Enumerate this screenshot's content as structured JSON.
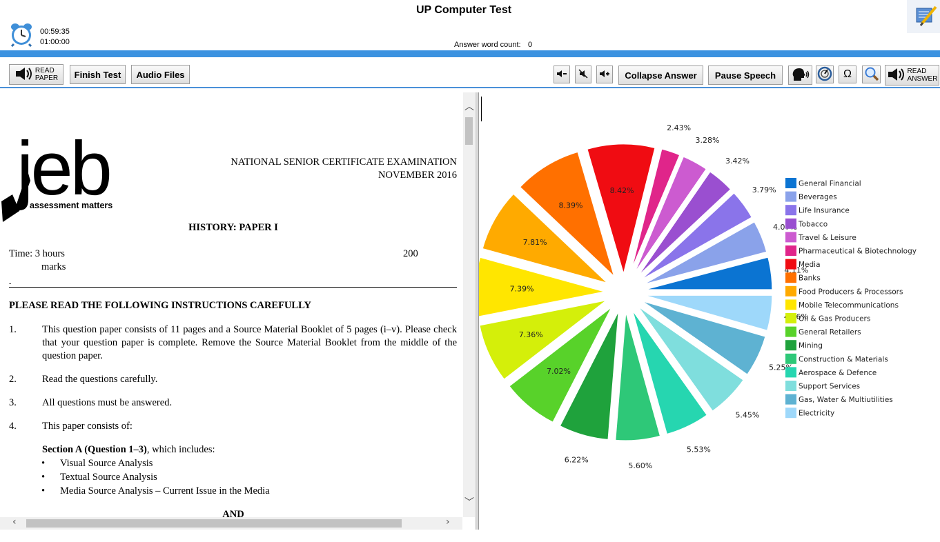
{
  "app": {
    "title": "UP Computer Test",
    "timer_elapsed": "00:59:35",
    "timer_total": "01:00:00",
    "word_count_label": "Answer word count:",
    "word_count_value": "0",
    "clock_icon": "alarm-clock-icon",
    "notes_icon": "notepad-pencil-icon"
  },
  "toolbar": {
    "read_paper": [
      "READ",
      "PAPER"
    ],
    "finish_test": "Finish Test",
    "audio_files": "Audio Files",
    "collapse_answer": "Collapse Answer",
    "pause_speech": "Pause Speech",
    "read_answer": [
      "READ",
      "ANSWER"
    ],
    "symbol": "Ω",
    "icons": [
      "speaker-icon",
      "volume-down-icon",
      "mute-icon",
      "volume-up-icon",
      "speaking-head-icon",
      "speed-dial-icon",
      "omega-icon",
      "magnifier-icon"
    ]
  },
  "document": {
    "logo_text": "jeb",
    "logo_tagline": "assessment matters",
    "exam_title": "NATIONAL SENIOR CERTIFICATE EXAMINATION",
    "exam_date": "NOVEMBER 2016",
    "paper_title": "HISTORY: PAPER I",
    "time_label": "Time: 3 hours",
    "marks_value": "200",
    "marks_label": "marks",
    "dash": "-",
    "instructions_heading": "PLEASE READ THE FOLLOWING INSTRUCTIONS CAREFULLY",
    "items": [
      {
        "num": "1.",
        "text": "This question paper consists of 11 pages and a Source Material Booklet of 5 pages (i–v). Please check that your question paper is complete. Remove the Source Material Booklet from the middle of the question paper."
      },
      {
        "num": "2.",
        "text": "Read the questions carefully."
      },
      {
        "num": "3.",
        "text": "All questions must be answered."
      },
      {
        "num": "4.",
        "text": "This paper consists of:"
      }
    ],
    "section_a_bold": "Section A (Question 1–3)",
    "section_a_rest": ", which includes:",
    "bullets": [
      "Visual Source Analysis",
      "Textual Source Analysis",
      "Media Source Analysis – Current Issue in the Media"
    ],
    "and_text": "AND"
  },
  "chart_data": {
    "type": "pie",
    "categories": [
      "General Financial",
      "Beverages",
      "Life Insurance",
      "Tobacco",
      "Travel & Leisure",
      "Pharmaceutical & Biotechnology",
      "Media",
      "Banks",
      "Food Producers & Processors",
      "Mobile Telecommunications",
      "Oil & Gas Producers",
      "General Retailers",
      "Mining",
      "Construction & Materials",
      "Aerospace & Defence",
      "Support Services",
      "Gas, Water & Multiutilities",
      "Electricity"
    ],
    "values": [
      4.11,
      4.07,
      3.79,
      3.42,
      3.28,
      2.43,
      8.42,
      8.39,
      7.81,
      7.39,
      7.36,
      7.02,
      6.22,
      5.6,
      5.53,
      5.45,
      5.25,
      4.46
    ],
    "labels": [
      "4.11%",
      "4.07%",
      "3.79%",
      "3.42%",
      "3.28%",
      "2.43%",
      "8.42%",
      "8.39%",
      "7.81%",
      "7.39%",
      "7.36%",
      "7.02%",
      "6.22%",
      "5.60%",
      "5.53%",
      "5.45%",
      "5.25%",
      "4.46%"
    ],
    "colors": [
      "#0b74d2",
      "#8aa2ea",
      "#8a74ea",
      "#9a4fd0",
      "#cc5bd0",
      "#e0258a",
      "#f00c12",
      "#ff7000",
      "#ffaa00",
      "#ffe600",
      "#d4ef0a",
      "#58d22a",
      "#1fa23c",
      "#2ec878",
      "#26d6b0",
      "#7fdedd",
      "#5eb2d2",
      "#9ed8fa"
    ],
    "legend_position": "right",
    "title": ""
  }
}
